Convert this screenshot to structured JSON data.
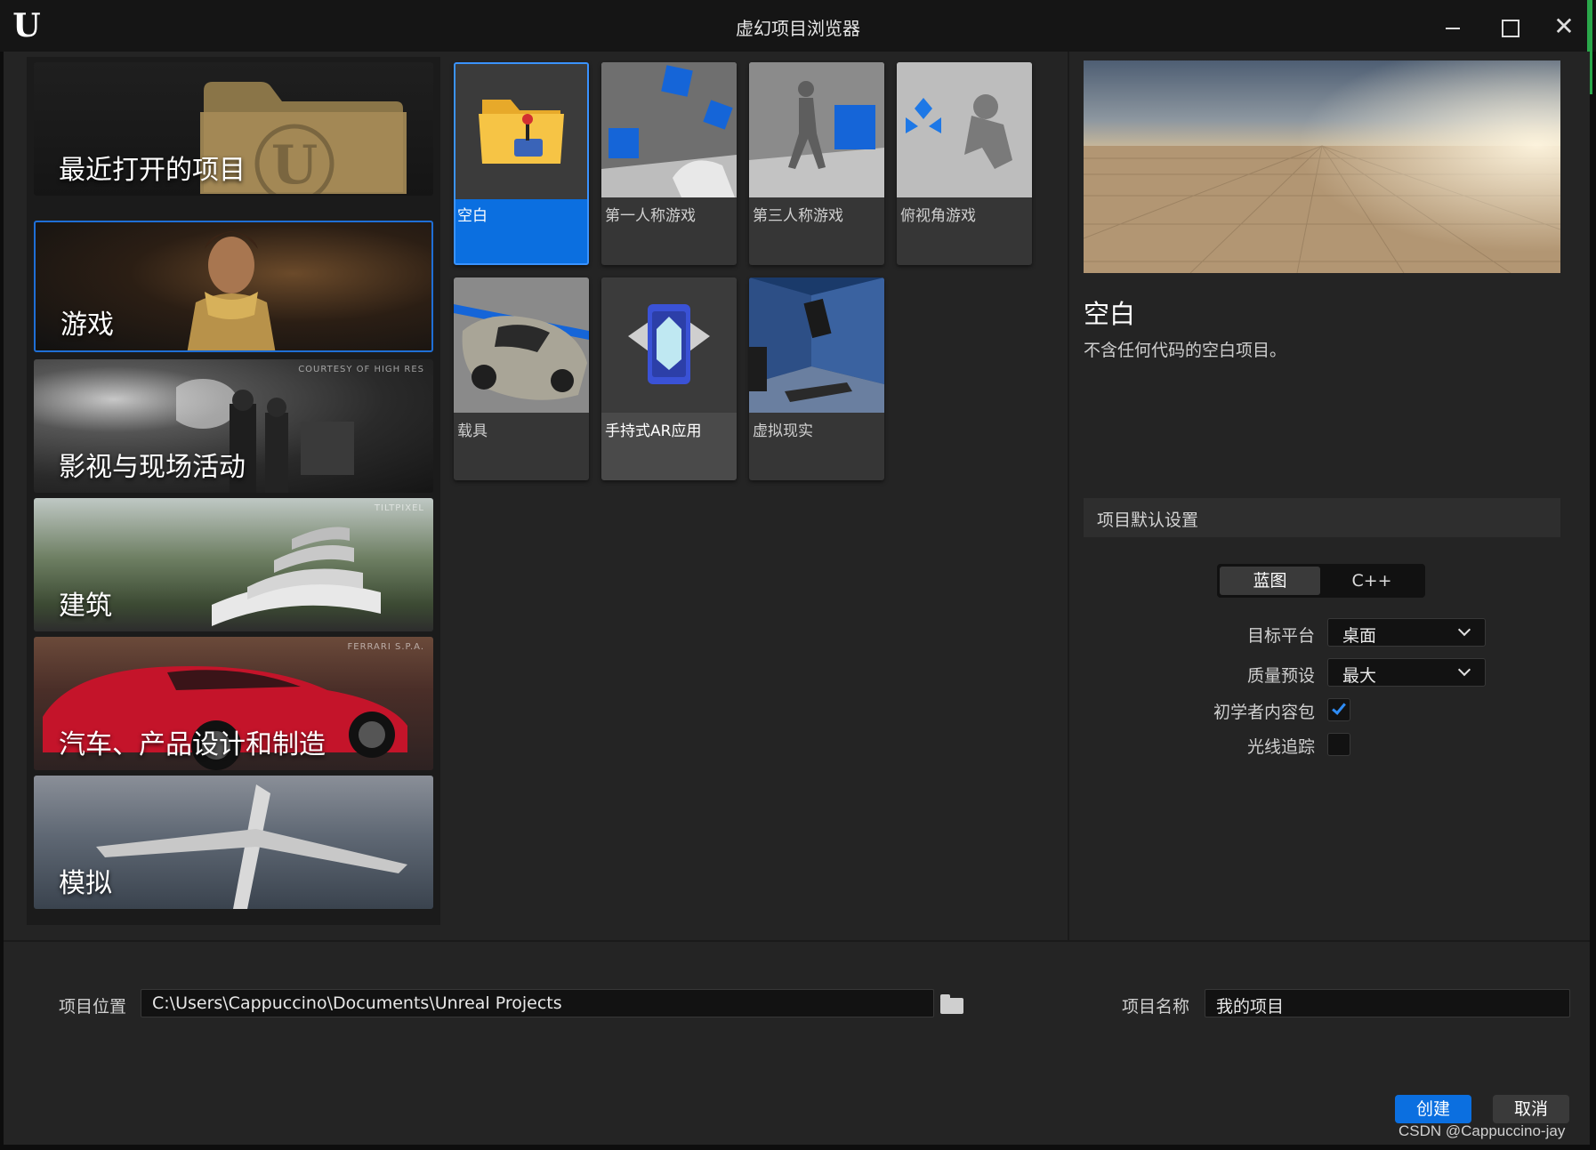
{
  "window": {
    "title": "虚幻项目浏览器",
    "logo": "U",
    "close_glyph": "✕"
  },
  "categories": [
    {
      "label": "最近打开的项目",
      "credit": ""
    },
    {
      "label": "游戏",
      "credit": ""
    },
    {
      "label": "影视与现场活动",
      "credit": "COURTESY OF HIGH RES"
    },
    {
      "label": "建筑",
      "credit": "TILTPIXEL"
    },
    {
      "label": "汽车、产品设计和制造",
      "credit": "FERRARI S.P.A."
    },
    {
      "label": "模拟",
      "credit": ""
    }
  ],
  "selected_category": "游戏",
  "templates": [
    {
      "label": "空白",
      "icon": "folder-joystick-icon"
    },
    {
      "label": "第一人称游戏",
      "icon": "first-person-thumbnail"
    },
    {
      "label": "第三人称游戏",
      "icon": "third-person-thumbnail"
    },
    {
      "label": "俯视角游戏",
      "icon": "top-down-thumbnail"
    },
    {
      "label": "载具",
      "icon": "vehicle-thumbnail"
    },
    {
      "label": "手持式AR应用",
      "icon": "phone-ar-icon"
    },
    {
      "label": "虚拟现实",
      "icon": "vr-thumbnail"
    }
  ],
  "selected_template": "空白",
  "details": {
    "title": "空白",
    "description": "不含任何代码的空白项目。"
  },
  "settings": {
    "header": "项目默认设置",
    "lang_options": [
      "蓝图",
      "C++"
    ],
    "lang_selected": "蓝图",
    "target_platform_label": "目标平台",
    "target_platform_value": "桌面",
    "quality_label": "质量预设",
    "quality_value": "最大",
    "starter_content_label": "初学者内容包",
    "starter_content_checked": true,
    "raytracing_label": "光线追踪",
    "raytracing_checked": false
  },
  "bottom": {
    "location_label": "项目位置",
    "location_value": "C:\\Users\\Cappuccino\\Documents\\Unreal Projects",
    "name_label": "项目名称",
    "name_value": "我的项目",
    "create_label": "创建",
    "cancel_label": "取消"
  },
  "watermark": "CSDN @Cappuccino-jay",
  "colors": {
    "accent": "#0b6fe0",
    "background": "#242424",
    "panel": "#1b1b1b",
    "titlebar": "#151515"
  }
}
